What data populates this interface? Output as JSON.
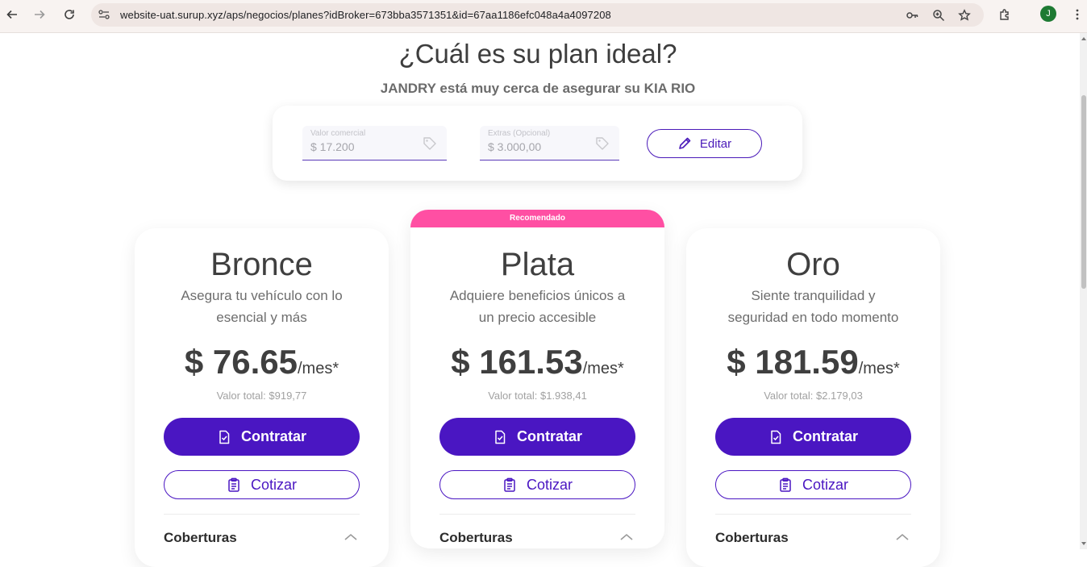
{
  "browser": {
    "url": "website-uat.surup.xyz/aps/negocios/planes?idBroker=673bba3571351&id=67aa1186efc048a4a4097208",
    "profile_initial": "J",
    "icons": [
      "back-icon",
      "forward-icon",
      "reload-icon",
      "site-info-icon",
      "password-key-icon",
      "zoom-icon",
      "bookmark-star-icon",
      "extensions-icon",
      "menu-icon"
    ]
  },
  "header": {
    "title": "¿Cuál es su plan ideal?",
    "subtitle": "JANDRY está muy cerca de asegurar su KIA RIO"
  },
  "values": {
    "commercial_label": "Valor comercial",
    "commercial_value": "$ 17.200",
    "extras_label": "Extras (Opcional)",
    "extras_value": "$ 3.000,00",
    "edit_label": "Editar"
  },
  "plans": [
    {
      "name": "Bronce",
      "desc_line1": "Asegura tu vehículo con lo",
      "desc_line2": "esencial y más",
      "price": "$ 76.65",
      "per": "/mes*",
      "total": "Valor total: $919,77",
      "contract_label": "Contratar",
      "quote_label": "Cotizar",
      "coverage_label": "Coberturas"
    },
    {
      "badge": "Recomendado",
      "name": "Plata",
      "desc_line1": "Adquiere beneficios únicos a",
      "desc_line2": "un precio accesible",
      "price": "$ 161.53",
      "per": "/mes*",
      "total": "Valor total: $1.938,41",
      "contract_label": "Contratar",
      "quote_label": "Cotizar",
      "coverage_label": "Coberturas"
    },
    {
      "name": "Oro",
      "desc_line1": "Siente tranquilidad y",
      "desc_line2": "seguridad en todo momento",
      "price": "$ 181.59",
      "per": "/mes*",
      "total": "Valor total: $2.179,03",
      "contract_label": "Contratar",
      "quote_label": "Cotizar",
      "coverage_label": "Coberturas"
    }
  ],
  "colors": {
    "primary": "#4a16c2",
    "badge": "#ff4fa3",
    "text_dark": "#3f3f3f",
    "text_muted": "#6d6d6d"
  }
}
